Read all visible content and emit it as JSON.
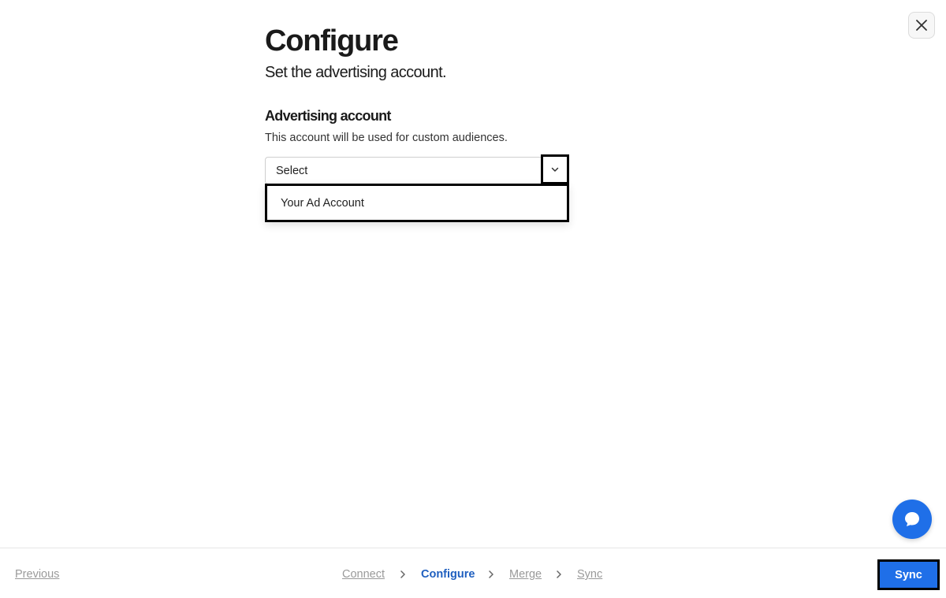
{
  "header": {
    "title": "Configure",
    "subtitle": "Set the advertising account."
  },
  "section": {
    "title": "Advertising account",
    "description": "This account will be used for custom audiences."
  },
  "select": {
    "value": "Select",
    "options": [
      "Your Ad Account"
    ]
  },
  "footer": {
    "previous_label": "Previous",
    "steps": [
      {
        "label": "Connect",
        "active": false
      },
      {
        "label": "Configure",
        "active": true
      },
      {
        "label": "Merge",
        "active": false
      },
      {
        "label": "Sync",
        "active": false
      }
    ],
    "sync_label": "Sync"
  },
  "icons": {
    "close": "close-icon",
    "chevron": "chevron-down-icon",
    "chat": "chat-bubble-icon",
    "step_separator": "chevron-right-icon"
  },
  "colors": {
    "accent": "#1f6fe8",
    "active_step": "#1f5fbf",
    "muted_text": "#9a9a9a"
  }
}
